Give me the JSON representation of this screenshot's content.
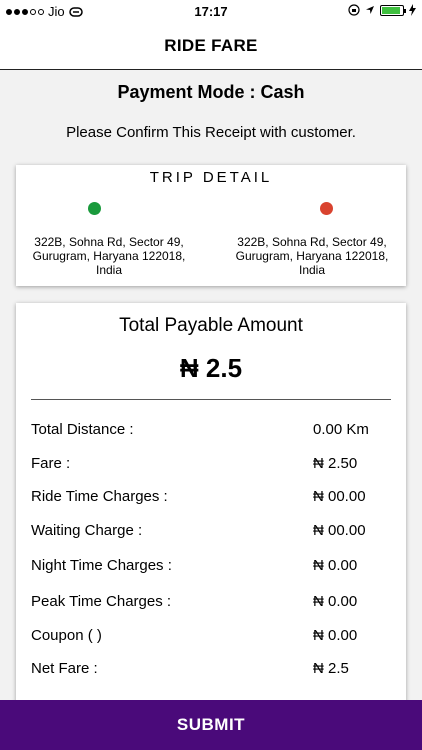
{
  "status_bar": {
    "carrier": "Jio",
    "time": "17:17",
    "battery_level": 0.9
  },
  "header": {
    "title": "RIDE FARE"
  },
  "payment_mode": "Payment Mode : Cash",
  "confirm_text": "Please Confirm This Receipt with customer.",
  "trip_detail": {
    "title": "TRIP DETAIL",
    "pickup_address": "322B, Sohna Rd, Sector 49, Gurugram, Haryana 122018, India",
    "drop_address": "322B, Sohna Rd, Sector 49, Gurugram, Haryana 122018, India",
    "pickup_color": "#1a9a3c",
    "drop_color": "#d9432f"
  },
  "fare": {
    "total_label": "Total Payable Amount",
    "total_value": "₦ 2.5",
    "rows": [
      {
        "label": "Total Distance :",
        "value": "0.00 Km"
      },
      {
        "label": "Fare :",
        "value": "₦ 2.50"
      },
      {
        "label": "Ride Time Charges :",
        "value": "₦ 00.00"
      },
      {
        "label": "Waiting Charge :",
        "value": "₦ 00.00"
      },
      {
        "label": "Night Time Charges :",
        "value": "₦ 0.00"
      },
      {
        "label": "Peak Time Charges :",
        "value": "₦ 0.00"
      },
      {
        "label": "Coupon ( )",
        "value": "₦ 0.00"
      },
      {
        "label": "Net Fare :",
        "value": "₦ 2.5"
      }
    ]
  },
  "submit_label": "SUBMIT",
  "colors": {
    "accent": "#4a0a7a"
  }
}
